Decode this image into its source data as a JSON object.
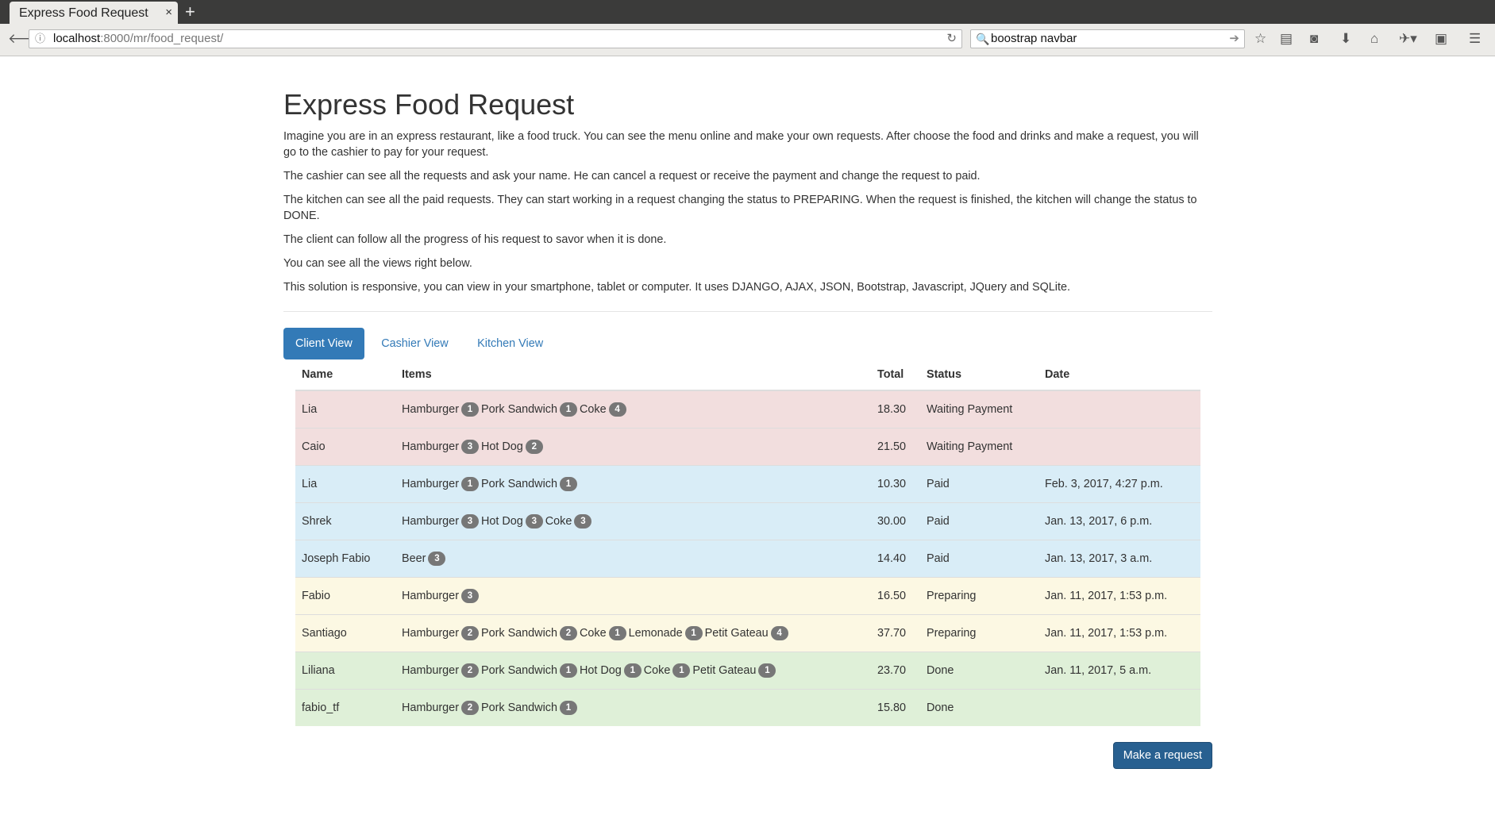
{
  "browser": {
    "tab_title": "Express Food Request",
    "tab_close": "×",
    "new_tab": "+",
    "url_host": "localhost",
    "url_path": ":8000/mr/food_request/",
    "search_text": "boostrap navbar"
  },
  "page": {
    "title": "Express Food Request",
    "paragraphs": [
      "Imagine you are in an express restaurant, like a food truck. You can see the menu online and make your own requests. After choose the food and drinks and make a request, you will go to the cashier to pay for your request.",
      "The cashier can see all the requests and ask your name. He can cancel a request or receive the payment and change the request to paid.",
      "The kitchen can see all the paid requests. They can start working in a request changing the status to PREPARING. When the request is finished, the kitchen will change the status to DONE.",
      "The client can follow all the progress of his request to savor when it is done.",
      "You can see all the views right below.",
      "This solution is responsive, you can view in your smartphone, tablet or computer. It uses DJANGO, AJAX, JSON, Bootstrap, Javascript, JQuery and SQLite."
    ],
    "tabs": [
      "Client View",
      "Cashier View",
      "Kitchen View"
    ],
    "active_tab": 0,
    "table": {
      "headers": [
        "Name",
        "Items",
        "Total",
        "Status",
        "Date"
      ],
      "rows": [
        {
          "state": "danger",
          "name": "Lia",
          "items": [
            [
              "Hamburger",
              "1"
            ],
            [
              "Pork Sandwich",
              "1"
            ],
            [
              "Coke",
              "4"
            ]
          ],
          "total": "18.30",
          "status": "Waiting Payment",
          "date": ""
        },
        {
          "state": "danger",
          "name": "Caio",
          "items": [
            [
              "Hamburger",
              "3"
            ],
            [
              "Hot Dog",
              "2"
            ]
          ],
          "total": "21.50",
          "status": "Waiting Payment",
          "date": ""
        },
        {
          "state": "info",
          "name": "Lia",
          "items": [
            [
              "Hamburger",
              "1"
            ],
            [
              "Pork Sandwich",
              "1"
            ]
          ],
          "total": "10.30",
          "status": "Paid",
          "date": "Feb. 3, 2017, 4:27 p.m."
        },
        {
          "state": "info",
          "name": "Shrek",
          "items": [
            [
              "Hamburger",
              "3"
            ],
            [
              "Hot Dog",
              "3"
            ],
            [
              "Coke",
              "3"
            ]
          ],
          "total": "30.00",
          "status": "Paid",
          "date": "Jan. 13, 2017, 6 p.m."
        },
        {
          "state": "info",
          "name": "Joseph Fabio",
          "items": [
            [
              "Beer",
              "3"
            ]
          ],
          "total": "14.40",
          "status": "Paid",
          "date": "Jan. 13, 2017, 3 a.m."
        },
        {
          "state": "warning",
          "name": "Fabio",
          "items": [
            [
              "Hamburger",
              "3"
            ]
          ],
          "total": "16.50",
          "status": "Preparing",
          "date": "Jan. 11, 2017, 1:53 p.m."
        },
        {
          "state": "warning",
          "name": "Santiago",
          "items": [
            [
              "Hamburger",
              "2"
            ],
            [
              "Pork Sandwich",
              "2"
            ],
            [
              "Coke",
              "1"
            ],
            [
              "Lemonade",
              "1"
            ],
            [
              "Petit Gateau",
              "4"
            ]
          ],
          "total": "37.70",
          "status": "Preparing",
          "date": "Jan. 11, 2017, 1:53 p.m."
        },
        {
          "state": "success",
          "name": "Liliana",
          "items": [
            [
              "Hamburger",
              "2"
            ],
            [
              "Pork Sandwich",
              "1"
            ],
            [
              "Hot Dog",
              "1"
            ],
            [
              "Coke",
              "1"
            ],
            [
              "Petit Gateau",
              "1"
            ]
          ],
          "total": "23.70",
          "status": "Done",
          "date": "Jan. 11, 2017, 5 a.m."
        },
        {
          "state": "success",
          "name": "fabio_tf",
          "items": [
            [
              "Hamburger",
              "2"
            ],
            [
              "Pork Sandwich",
              "1"
            ]
          ],
          "total": "15.80",
          "status": "Done",
          "date": ""
        }
      ]
    },
    "button_label": "Make a request"
  },
  "colors": {
    "primary": "#337ab7",
    "button": "#286090",
    "danger_row": "#f2dede",
    "info_row": "#d9edf7",
    "warning_row": "#fcf8e3",
    "success_row": "#dff0d8",
    "badge": "#777777"
  }
}
